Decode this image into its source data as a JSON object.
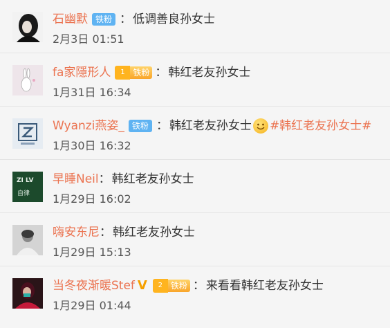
{
  "comments": [
    {
      "name": "石幽默",
      "badge": "铁粉",
      "colon": "：",
      "text": "低调善良孙女士",
      "time": "2月3日 01:51"
    },
    {
      "name": "fa家隱形人",
      "badge_level": "1",
      "badge": "铁粉",
      "colon": "：",
      "text": "韩红老友孙女士",
      "time": "1月31日 16:34"
    },
    {
      "name": "Wyanzi燕姿_",
      "badge": "铁粉",
      "colon": "：",
      "text": "韩红老友孙女士",
      "tag": "#韩红老友孙女士#",
      "time": "1月30日 16:32"
    },
    {
      "name": "早睡Neil",
      "colon": "：",
      "text": "韩红老友孙女士",
      "time": "1月29日 16:02"
    },
    {
      "name": "嗨安东尼",
      "colon": "：",
      "text": "韩红老友孙女士",
      "time": "1月29日 15:13"
    },
    {
      "name": "当冬夜渐暖Stef",
      "v_mark": "V",
      "badge_level": "2",
      "badge": "铁粉",
      "colon": "：",
      "text": "来看看韩红老友孙女士",
      "time": "1月29日 01:44"
    }
  ],
  "avatars": {
    "a4_text1": "ZI LV",
    "a4_text2": "自律"
  },
  "colors": {
    "name": "#eb7350",
    "badge_blue": "#5fb3f2",
    "badge_gold": "#f5a524"
  }
}
